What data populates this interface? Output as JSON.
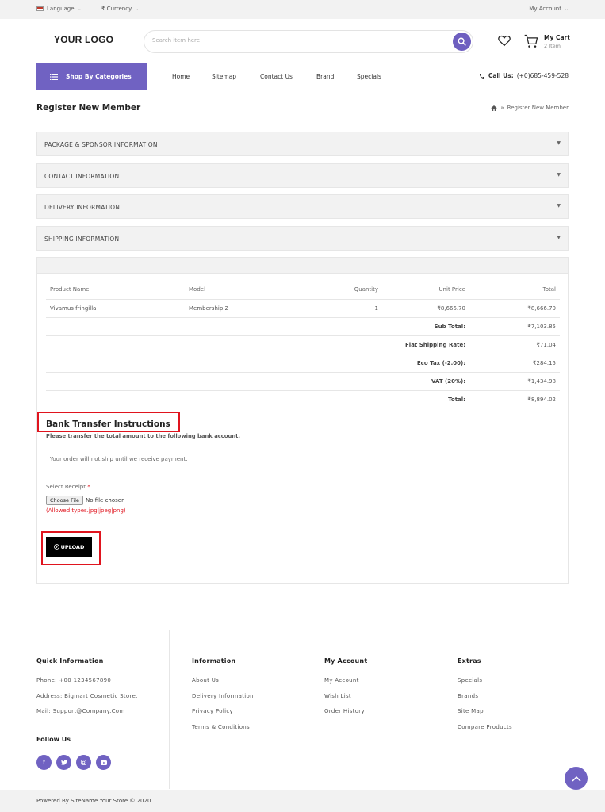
{
  "topbar": {
    "language": "Language",
    "currency": "₹ Currency",
    "account": "My Account"
  },
  "header": {
    "logo": "YOUR LOGO",
    "search_placeholder": "Search item here",
    "cart_title": "My Cart",
    "cart_count": "2 Item"
  },
  "nav": {
    "categories": "Shop By Categories",
    "links": [
      "Home",
      "Sitemap",
      "Contact Us",
      "Brand",
      "Specials"
    ],
    "call_label": "Call Us:",
    "call_number": "(+0)685-459-528"
  },
  "page": {
    "title": "Register New Member",
    "breadcrumb": "Register New Member"
  },
  "accordions": [
    "PACKAGE & SPONSOR INFORMATION",
    "CONTACT INFORMATION",
    "DELIVERY INFORMATION",
    "SHIPPING INFORMATION"
  ],
  "order": {
    "headers": [
      "Product Name",
      "Model",
      "Quantity",
      "Unit Price",
      "Total"
    ],
    "item": {
      "name": "Vivamus fringilla",
      "model": "Membership 2",
      "qty": "1",
      "unit": "₹8,666.70",
      "total": "₹8,666.70"
    },
    "totals": [
      {
        "label": "Sub Total:",
        "value": "₹7,103.85"
      },
      {
        "label": "Flat Shipping Rate:",
        "value": "₹71.04"
      },
      {
        "label": "Eco Tax (-2.00):",
        "value": "₹284.15"
      },
      {
        "label": "VAT (20%):",
        "value": "₹1,434.98"
      },
      {
        "label": "Total:",
        "value": "₹8,894.02"
      }
    ]
  },
  "bank": {
    "title": "Bank Transfer Instructions",
    "desc": "Please transfer the total amount to the following bank account.",
    "note": "Your order will not ship until we receive payment.",
    "receipt_label": "Select Receipt",
    "required_mark": "*",
    "choose_file": "Choose File",
    "no_file": "No file chosen",
    "allowed": "(Allowed types.jpg|jpeg|png)",
    "upload": "UPLOAD"
  },
  "footer": {
    "quick": {
      "title": "Quick Information",
      "phone": "Phone:  +00 1234567890",
      "address": "Address:  Bigmart Cosmetic Store.",
      "mail": "Mail:  Support@Company.Com"
    },
    "follow": "Follow Us",
    "socials": [
      "f",
      "t",
      "ig",
      "yt"
    ],
    "information": {
      "title": "Information",
      "items": [
        "About Us",
        "Delivery Information",
        "Privacy Policy",
        "Terms & Conditions"
      ]
    },
    "account": {
      "title": "My Account",
      "items": [
        "My Account",
        "Wish List",
        "Order History"
      ]
    },
    "extras": {
      "title": "Extras",
      "items": [
        "Specials",
        "Brands",
        "Site Map",
        "Compare Products"
      ]
    },
    "copyright": "Powered By SiteName Your Store © 2020"
  },
  "colors": {
    "accent": "#7062c2",
    "highlight": "#e0141e"
  }
}
